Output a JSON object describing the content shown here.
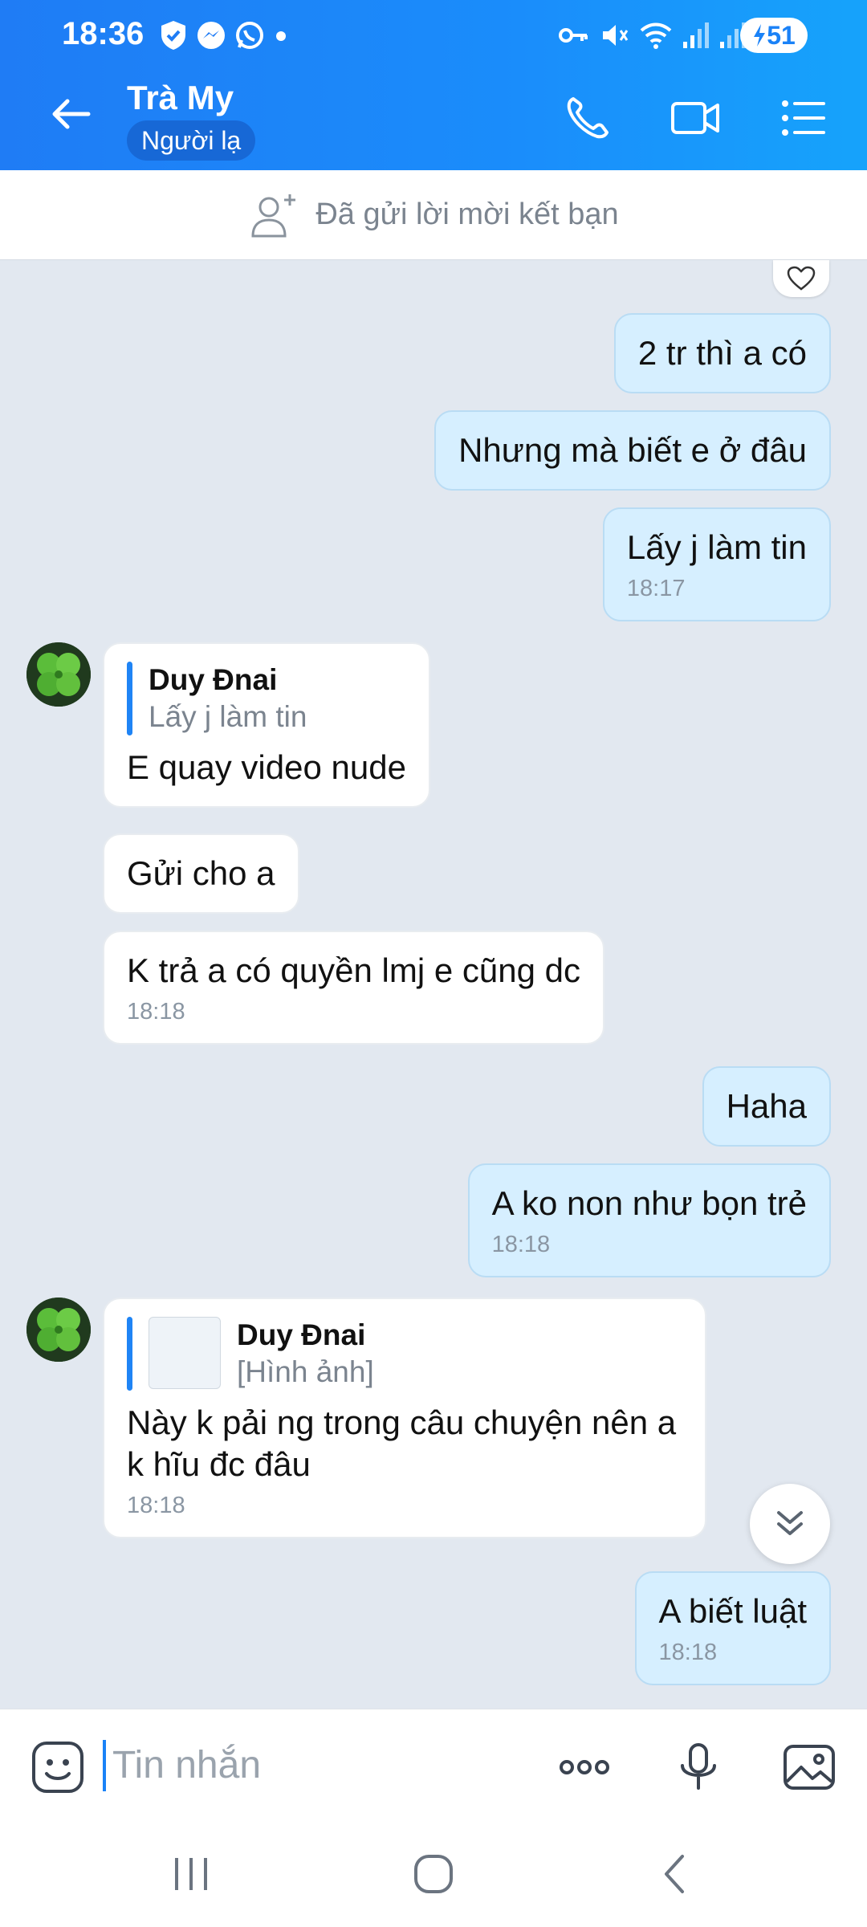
{
  "status_bar": {
    "time": "18:36",
    "battery": "51"
  },
  "header": {
    "contact_name": "Trà My",
    "badge": "Người lạ"
  },
  "friend_bar": {
    "text": "Đã gửi lời mời kết bạn"
  },
  "messages": [
    {
      "dir": "out",
      "text": "2 tr thì a có"
    },
    {
      "dir": "out",
      "text": "Nhưng mà biết e ở đâu"
    },
    {
      "dir": "out",
      "text": "Lấy j làm tin",
      "time": "18:17"
    },
    {
      "dir": "in",
      "quote_name": "Duy Đnai",
      "quote_text": "Lấy j làm tin",
      "text": "E quay video nude"
    },
    {
      "dir": "in",
      "text": "Gửi cho a"
    },
    {
      "dir": "in",
      "text": "K trả a có quyền lmj e cũng dc",
      "time": "18:18"
    },
    {
      "dir": "out",
      "text": "Haha"
    },
    {
      "dir": "out",
      "text": "A ko non như bọn trẻ",
      "time": "18:18"
    },
    {
      "dir": "in",
      "quote_name": "Duy Đnai",
      "quote_text": "[Hình ảnh]",
      "text": "Này k pải ng trong câu chuyện nên a k hĩu đc đâu",
      "time": "18:18"
    },
    {
      "dir": "out",
      "text": "A biết luật",
      "time": "18:18"
    }
  ],
  "input": {
    "placeholder": "Tin nhắn"
  },
  "colors": {
    "header": "#1f7cf5",
    "outgoing_bubble": "#d6efff",
    "incoming_bubble": "#ffffff",
    "chat_bg": "#e2e8f0"
  }
}
